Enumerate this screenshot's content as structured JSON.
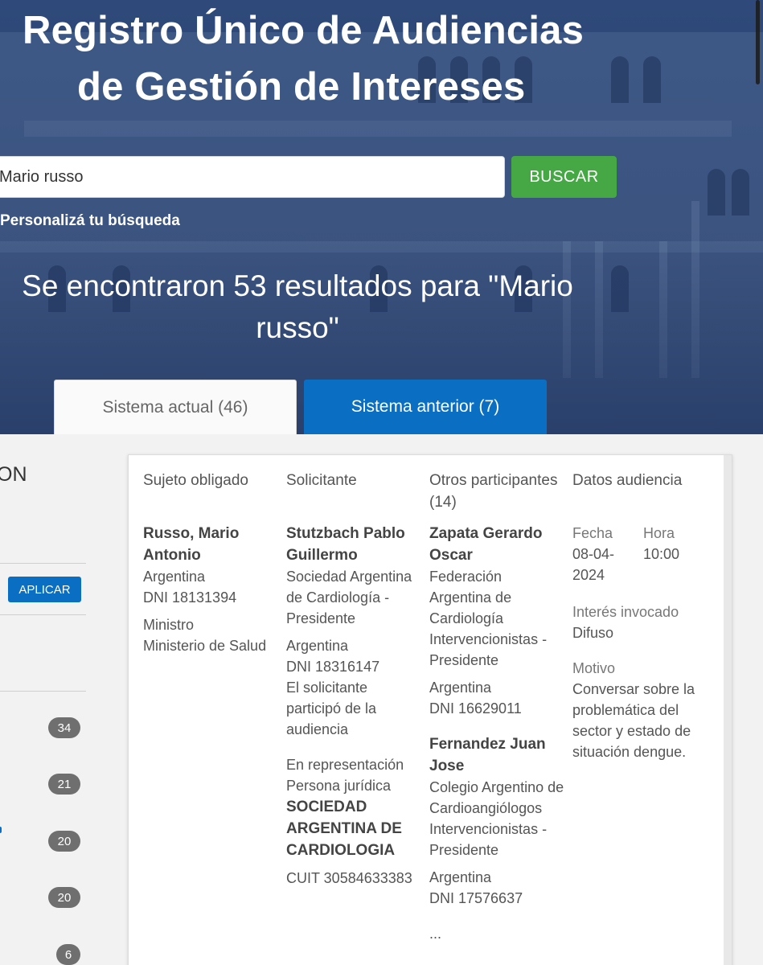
{
  "header": {
    "title_line1": "Registro Único de Audiencias",
    "title_line2": "de Gestión de Intereses"
  },
  "search": {
    "value": "Mario russo",
    "button_label": "BUSCAR",
    "customize_link": "Personalizá tu búsqueda"
  },
  "results": {
    "heading": "Se encontraron 53 resultados para \"Mario russo\""
  },
  "tabs": [
    {
      "label": "Sistema actual (46)",
      "active": false
    },
    {
      "label": "Sistema anterior (7)",
      "active": true
    }
  ],
  "sidebar": {
    "heading_fragment": "ON",
    "apply_label": "APLICAR",
    "counts": [
      "34",
      "21",
      "20",
      "20",
      "6"
    ]
  },
  "card": {
    "headers": {
      "sujeto": "Sujeto obligado",
      "solicitante": "Solicitante",
      "otros": "Otros participantes (14)",
      "datos": "Datos audiencia"
    },
    "sujeto": {
      "name": "Russo, Mario Antonio",
      "country": "Argentina",
      "dni": "DNI 18131394",
      "role": "Ministro",
      "org": "Ministerio de Salud"
    },
    "solicitante": {
      "name": "Stutzbach Pablo Guillermo",
      "org": "Sociedad Argentina de Cardiología - Presidente",
      "country": "Argentina",
      "dni": "DNI 18316147",
      "note": "El solicitante participó de la audiencia",
      "rep_label": "En representación",
      "rep_type": "Persona jurídica",
      "rep_name": "SOCIEDAD ARGENTINA DE CARDIOLOGIA",
      "cuit": "CUIT 30584633383"
    },
    "otros": [
      {
        "name": "Zapata Gerardo Oscar",
        "org": "Federación Argentina de Cardiología Intervencionistas - Presidente",
        "country": "Argentina",
        "dni": "DNI 16629011"
      },
      {
        "name": "Fernandez Juan Jose",
        "org": "Colegio Argentino de Cardioangiólogos Intervencionistas - Presidente",
        "country": "Argentina",
        "dni": "DNI 17576637"
      }
    ],
    "otros_more": "...",
    "datos": {
      "fecha_label": "Fecha",
      "fecha": "08-04-2024",
      "hora_label": "Hora",
      "hora": "10:00",
      "interes_label": "Interés invocado",
      "interes": "Difuso",
      "motivo_label": "Motivo",
      "motivo": "Conversar sobre la problemática del sector y estado de situación dengue."
    }
  }
}
